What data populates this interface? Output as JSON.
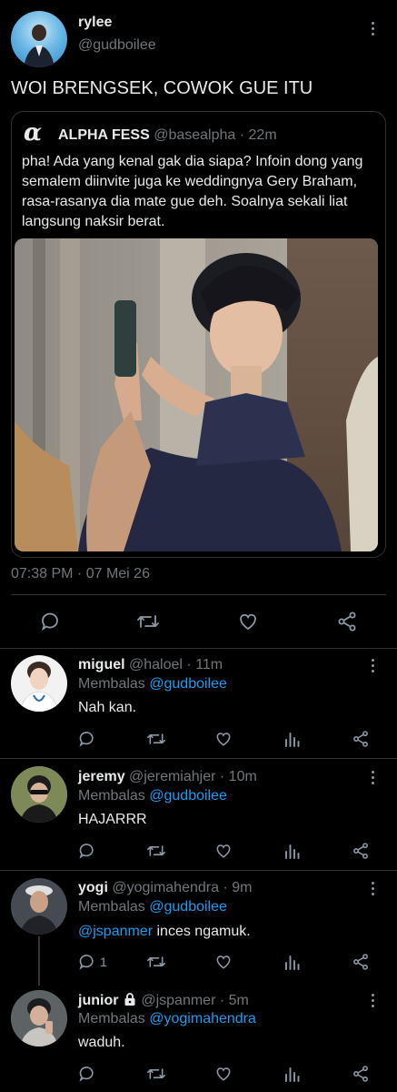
{
  "main_tweet": {
    "name": "rylee",
    "handle": "@gudboilee",
    "text": "WOI BRENGSEK, COWOK GUE ITU",
    "timestamp": "07:38 PM · 07 Mei 26"
  },
  "quote": {
    "logo": "α",
    "name": "ALPHA FESS",
    "handle": "@basealpha",
    "time": "· 22m",
    "text": "pha! Ada yang kenal gak dia siapa? Infoin dong yang semalem diinvite juga ke weddingnya Gery Braham, rasa-rasanya dia mate gue deh. Soalnya sekali liat langsung naksir berat."
  },
  "replies": [
    {
      "name": "miguel",
      "handle": "@haloel",
      "time": "· 11m",
      "replying_label": "Membalas",
      "replying_to": "@gudboilee",
      "mention": "",
      "text": "Nah kan.",
      "reply_count": ""
    },
    {
      "name": "jeremy",
      "handle": "@jeremiahjer",
      "time": "· 10m",
      "replying_label": "Membalas",
      "replying_to": "@gudboilee",
      "mention": "",
      "text": "HAJARRR",
      "reply_count": ""
    },
    {
      "name": "yogi",
      "handle": "@yogimahendra",
      "time": "· 9m",
      "replying_label": "Membalas",
      "replying_to": "@gudboilee",
      "mention": "@jspanmer",
      "text": " inces ngamuk.",
      "reply_count": "1"
    },
    {
      "name": "junior",
      "handle": "@jspanmer",
      "time": "· 5m",
      "replying_label": "Membalas",
      "replying_to": "@yogimahendra",
      "mention": "",
      "text": "waduh.",
      "reply_count": ""
    }
  ],
  "icons": {
    "reply": "reply-icon",
    "retweet": "retweet-icon",
    "like": "like-icon",
    "share": "share-icon",
    "views": "views-icon",
    "lock": "lock-icon",
    "more": "more-icon"
  },
  "colors": {
    "background": "#000000",
    "text": "#e7e9ea",
    "muted": "#71767b",
    "link": "#1d9bf0",
    "border": "#2f3336"
  }
}
